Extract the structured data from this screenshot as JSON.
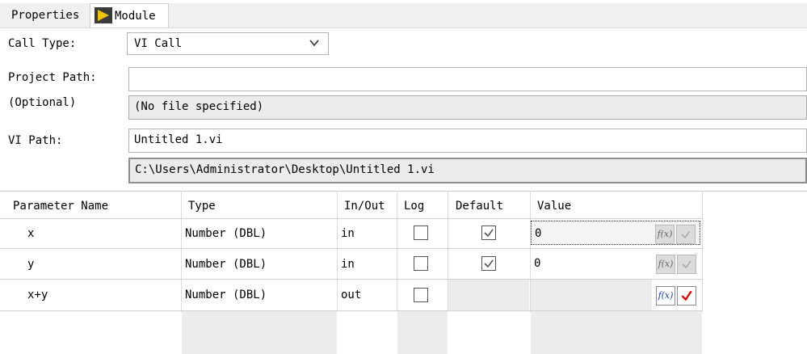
{
  "tabs": {
    "properties": "Properties",
    "module": "Module"
  },
  "form": {
    "call_type_label": "Call Type:",
    "call_type_value": "VI Call",
    "project_path_label": "Project Path:",
    "optional_label": "(Optional)",
    "project_path_value": "",
    "project_path_resolved": "(No file specified)",
    "vi_path_label": "VI Path:",
    "vi_path_value": "Untitled 1.vi",
    "vi_path_resolved": "C:\\Users\\Administrator\\Desktop\\Untitled 1.vi"
  },
  "table": {
    "headers": [
      "Parameter Name",
      "Type",
      "In/Out",
      "Log",
      "Default",
      "Value"
    ],
    "rows": [
      {
        "name": "x",
        "type": "Number (DBL)",
        "inout": "in",
        "log": false,
        "default": true,
        "value": "0"
      },
      {
        "name": "y",
        "type": "Number (DBL)",
        "inout": "in",
        "log": false,
        "default": true,
        "value": "0"
      },
      {
        "name": "x+y",
        "type": "Number (DBL)",
        "inout": "out",
        "log": false,
        "default": null,
        "value": ""
      }
    ],
    "fx_label": "f(x)"
  },
  "icons": {
    "module_icon": "labview-vi-icon",
    "dropdown": "chevron-down-icon",
    "checkmark": "check-icon"
  },
  "colors": {
    "icon_yellow": "#f2c200",
    "check_red": "#e00000",
    "fx_blue": "#1f3fbf"
  }
}
